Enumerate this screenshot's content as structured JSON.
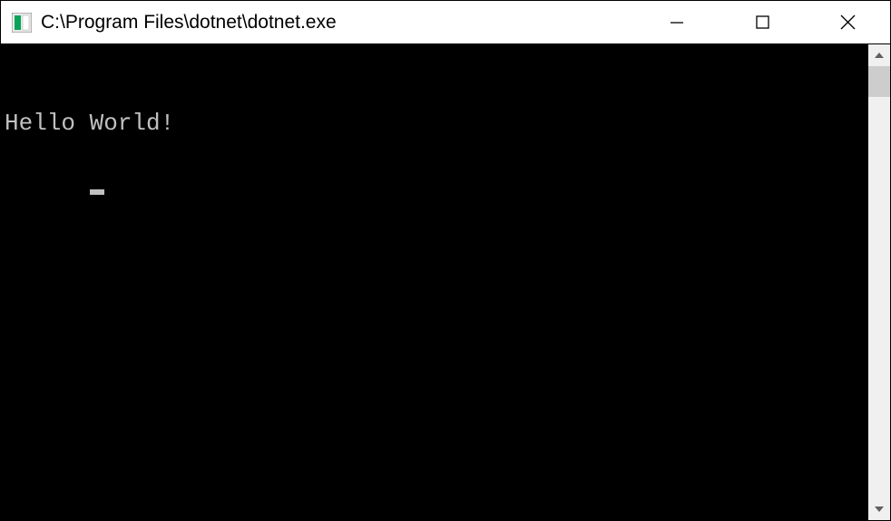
{
  "window": {
    "title": "C:\\Program Files\\dotnet\\dotnet.exe"
  },
  "console": {
    "lines": [
      "Hello World!"
    ]
  }
}
